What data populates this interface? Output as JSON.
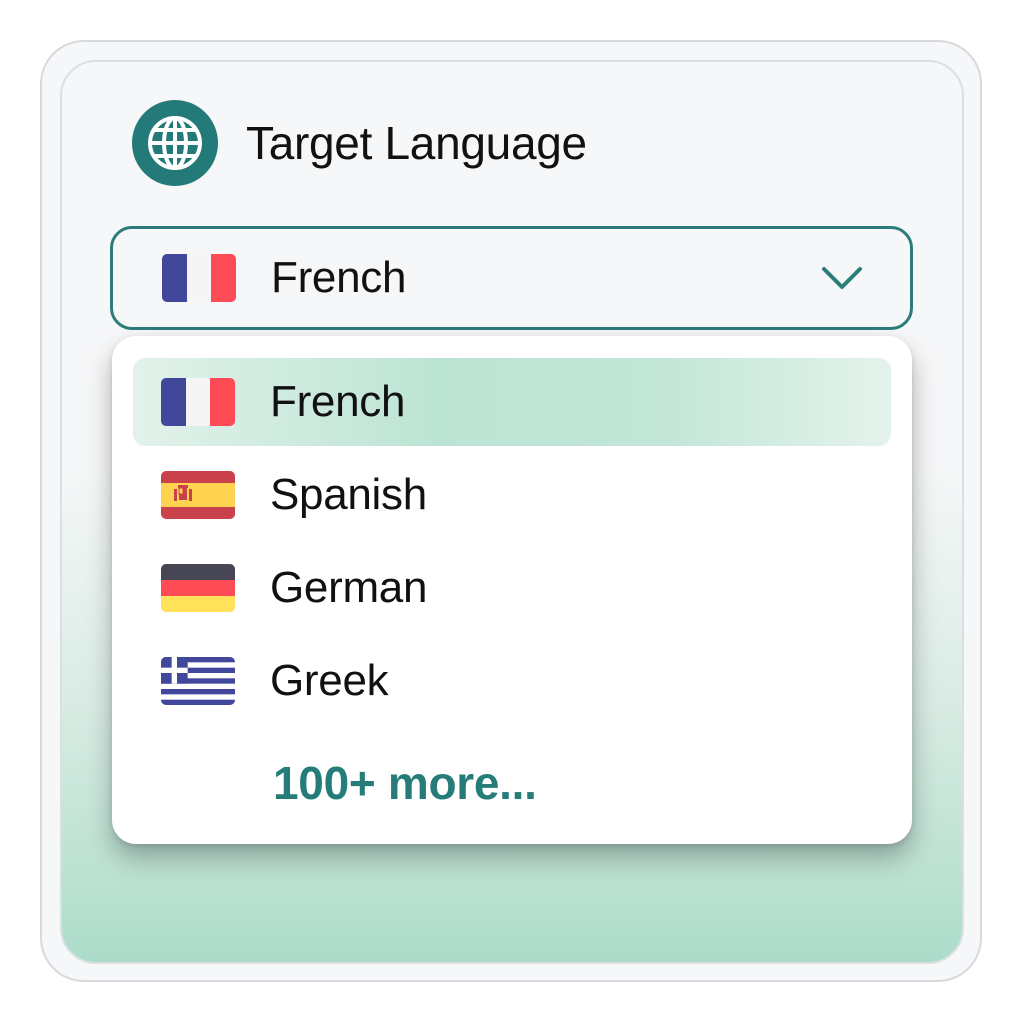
{
  "header": {
    "title": "Target Language",
    "icon": "globe-icon"
  },
  "select": {
    "value": "French",
    "flag": "french-flag-icon",
    "chevron": "chevron-down-icon"
  },
  "dropdown": {
    "options": [
      {
        "label": "French",
        "flag": "french-flag-icon",
        "selected": true
      },
      {
        "label": "Spanish",
        "flag": "spanish-flag-icon",
        "selected": false
      },
      {
        "label": "German",
        "flag": "german-flag-icon",
        "selected": false
      },
      {
        "label": "Greek",
        "flag": "greek-flag-icon",
        "selected": false
      }
    ],
    "more_label": "100+ more..."
  },
  "colors": {
    "accent": "#237a78",
    "selected_highlight": "#bce4d4",
    "gradient_bottom": "#acdcc9"
  }
}
